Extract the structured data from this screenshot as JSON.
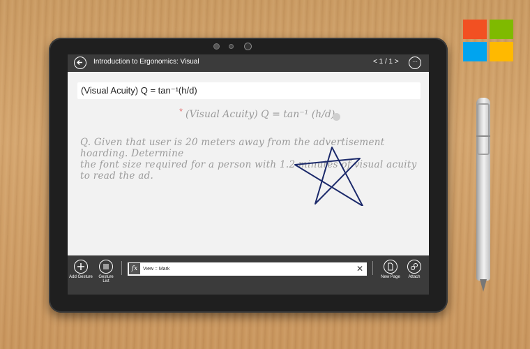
{
  "app": {
    "document_title": "Introduction to Ergonomics: Visual",
    "pager": "< 1 / 1 >",
    "more_label": "···"
  },
  "formula_bar": {
    "text": "(Visual Acuity) Q = tan⁻¹(h/d)"
  },
  "canvas": {
    "handwritten_title": "(Visual Acuity) Q = tan⁻¹ (h/d)",
    "handwritten_question_line1": "Q. Given that user is 20 meters away from the advertisement hoarding. Determine",
    "handwritten_question_line2": "the font size required for a person with 1.2 minutes of visual acuity to read the ad.",
    "star_color": "#1c2a6b",
    "asterisk": "*"
  },
  "toolbar": {
    "add_gesture": "Add Gesture",
    "gesture_list": "Gesture List",
    "new_page": "New Page",
    "attach": "Attach",
    "fx_label": "fx",
    "command_value": "View :: Mark",
    "clear_symbol": "✕"
  },
  "brand": {
    "logo_colors": [
      "#f25022",
      "#7fba00",
      "#00a4ef",
      "#ffb900"
    ]
  }
}
